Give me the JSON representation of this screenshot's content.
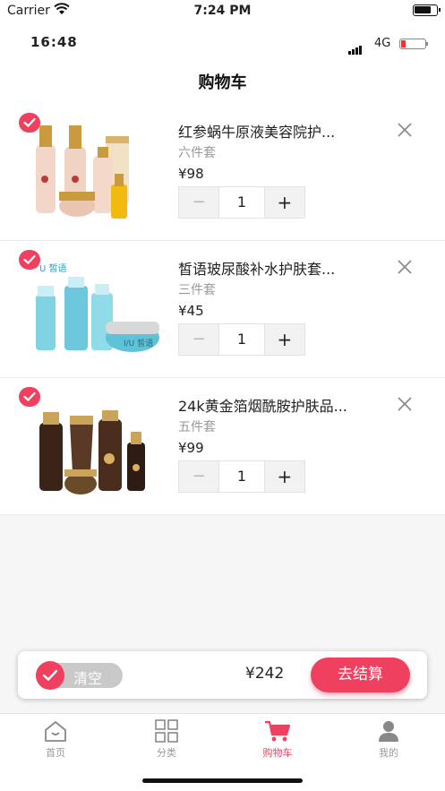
{
  "status_bar": {
    "carrier": "Carrier",
    "time": "7:24 PM"
  },
  "inner_status": {
    "time": "16:48",
    "network": "4G"
  },
  "nav": {
    "title": "购物车"
  },
  "items": [
    {
      "name": "红参蜗牛原液美容院护...",
      "spec": "六件套",
      "price": "¥98",
      "qty": "1",
      "minus": "−",
      "plus": "+",
      "image": "red-ginseng-snail-skincare-set"
    },
    {
      "name": "皙语玻尿酸补水护肤套...",
      "spec": "三件套",
      "price": "¥45",
      "qty": "1",
      "minus": "−",
      "plus": "+",
      "image": "hyaluronic-acid-skincare-set",
      "brand_mark": "U 皙语"
    },
    {
      "name": "24k黄金箔烟酰胺护肤品...",
      "spec": "五件套",
      "price": "¥99",
      "qty": "1",
      "minus": "−",
      "plus": "+",
      "image": "24k-gold-foil-skincare-set"
    }
  ],
  "checkout": {
    "clear_label": "清空",
    "total": "¥242",
    "pay_label": "去结算"
  },
  "tabs": [
    {
      "label": "首页",
      "icon": "home-icon"
    },
    {
      "label": "分类",
      "icon": "grid-icon"
    },
    {
      "label": "购物车",
      "icon": "cart-icon",
      "active": true
    },
    {
      "label": "我的",
      "icon": "user-icon"
    }
  ],
  "colors": {
    "accent": "#f0405f",
    "inactive": "#999999"
  }
}
